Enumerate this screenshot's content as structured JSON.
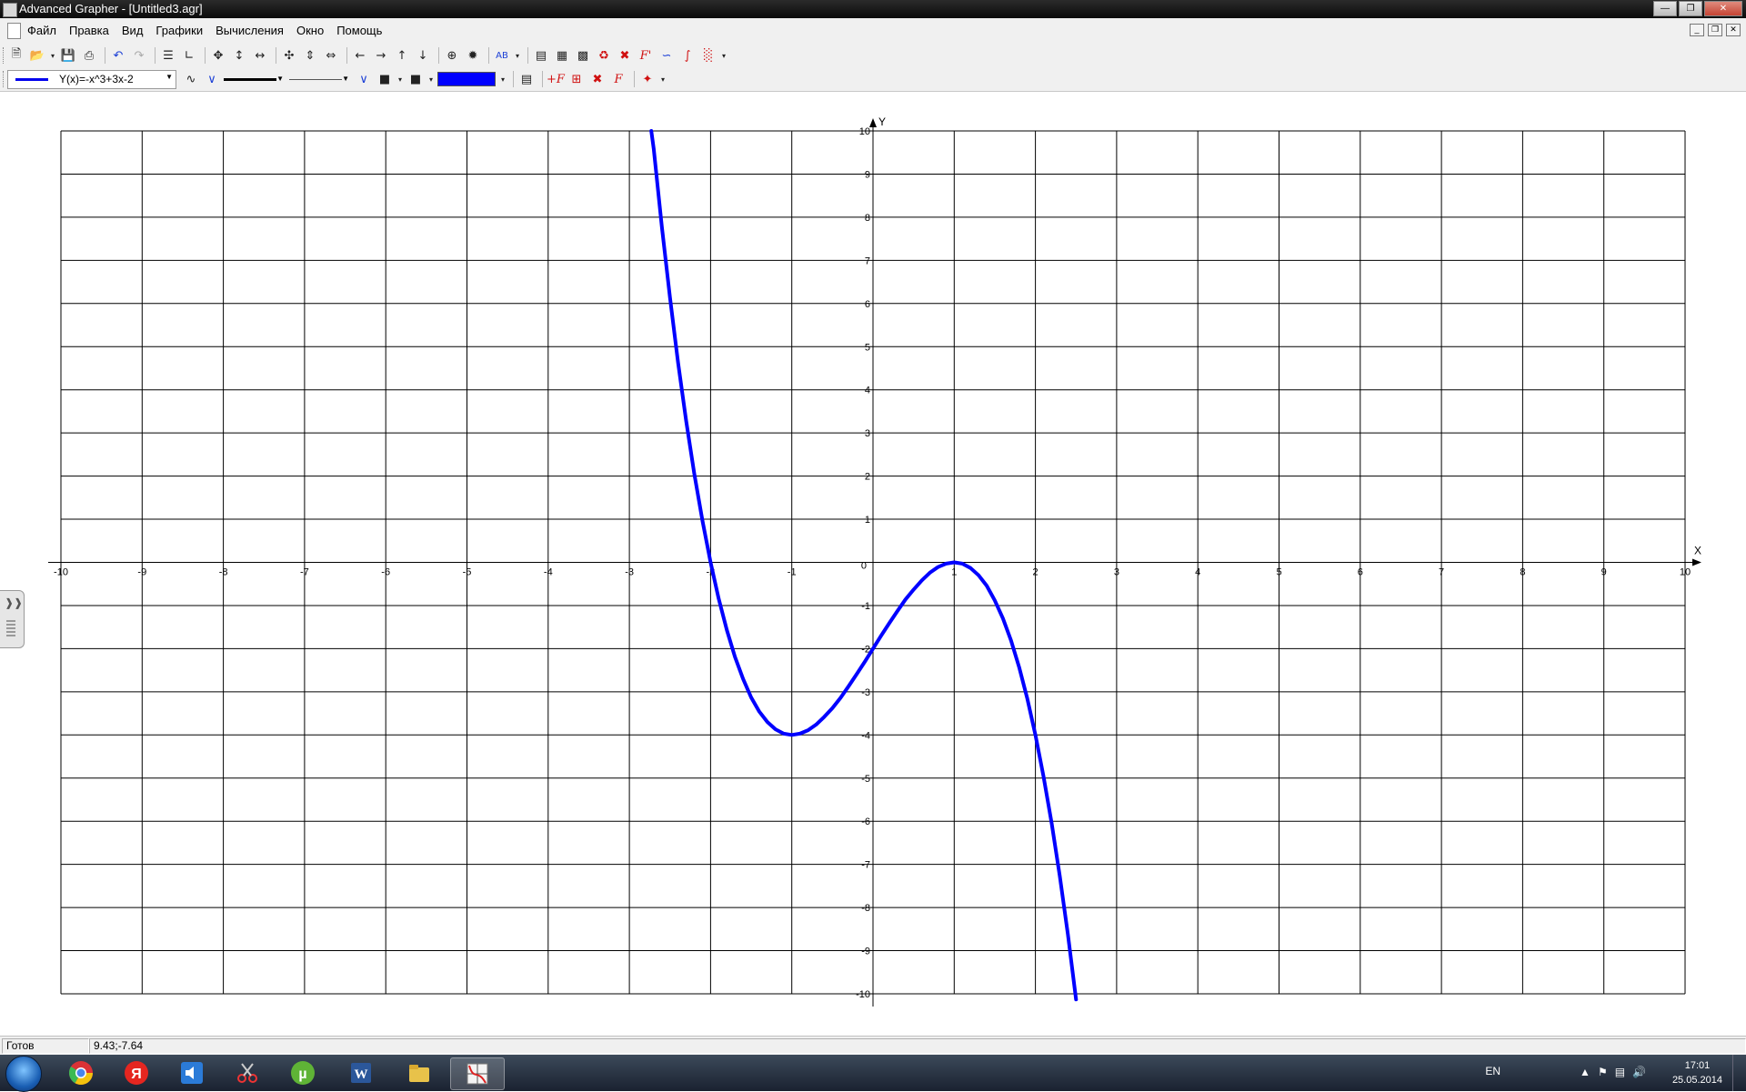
{
  "window": {
    "title": "Advanced Grapher - [Untitled3.agr]"
  },
  "menu": {
    "items": [
      "Файл",
      "Правка",
      "Вид",
      "Графики",
      "Вычисления",
      "Окно",
      "Помощь"
    ]
  },
  "toolbar2": {
    "function_label": "Y(x)=-x^3+3x-2",
    "line_color": "#0000ff"
  },
  "chart_data": {
    "type": "line",
    "xlabel": "X",
    "ylabel": "Y",
    "xlim": [
      -10,
      10
    ],
    "ylim": [
      -10,
      10
    ],
    "grid": true,
    "x_ticks": [
      -10,
      -9,
      -8,
      -7,
      -6,
      -5,
      -4,
      -3,
      -2,
      -1,
      0,
      1,
      2,
      3,
      4,
      5,
      6,
      7,
      8,
      9,
      10
    ],
    "y_ticks": [
      -10,
      -9,
      -8,
      -7,
      -6,
      -5,
      -4,
      -3,
      -2,
      -1,
      0,
      1,
      2,
      3,
      4,
      5,
      6,
      7,
      8,
      9,
      10
    ],
    "series": [
      {
        "name": "Y(x)=-x^3+3x-2",
        "color": "#0000ff",
        "x": [
          -2.73,
          -2.7,
          -2.6,
          -2.5,
          -2.4,
          -2.3,
          -2.2,
          -2.1,
          -2.0,
          -1.9,
          -1.8,
          -1.7,
          -1.6,
          -1.5,
          -1.4,
          -1.3,
          -1.2,
          -1.1,
          -1.0,
          -0.9,
          -0.8,
          -0.7,
          -0.6,
          -0.5,
          -0.4,
          -0.3,
          -0.2,
          -0.1,
          0.0,
          0.1,
          0.2,
          0.3,
          0.4,
          0.5,
          0.6,
          0.7,
          0.8,
          0.9,
          1.0,
          1.1,
          1.2,
          1.3,
          1.4,
          1.5,
          1.6,
          1.7,
          1.8,
          1.9,
          2.0,
          2.1,
          2.2,
          2.3,
          2.4,
          2.5
        ],
        "y": [
          10.0,
          9.58,
          7.78,
          6.13,
          4.62,
          3.27,
          2.05,
          0.96,
          0.0,
          -0.84,
          -1.57,
          -2.19,
          -2.7,
          -3.13,
          -3.46,
          -3.7,
          -3.87,
          -3.97,
          -4.0,
          -3.97,
          -3.89,
          -3.76,
          -3.58,
          -3.38,
          -3.14,
          -2.87,
          -2.59,
          -2.3,
          -2.0,
          -1.7,
          -1.41,
          -1.13,
          -0.86,
          -0.63,
          -0.42,
          -0.24,
          -0.11,
          -0.03,
          0.0,
          -0.03,
          -0.13,
          -0.3,
          -0.54,
          -0.88,
          -1.3,
          -1.81,
          -2.43,
          -3.16,
          -4.0,
          -4.96,
          -6.05,
          -7.27,
          -8.62,
          -10.13
        ]
      }
    ]
  },
  "status": {
    "state": "Готов",
    "coords": "9.43;-7.64"
  },
  "taskbar": {
    "apps": [
      "chrome-icon",
      "yandex-icon",
      "audio-icon",
      "scissors-icon",
      "utorrent-icon",
      "word-icon",
      "explorer-icon",
      "advanced-grapher-icon"
    ],
    "lang": "EN",
    "time": "17:01",
    "date": "25.05.2014"
  }
}
